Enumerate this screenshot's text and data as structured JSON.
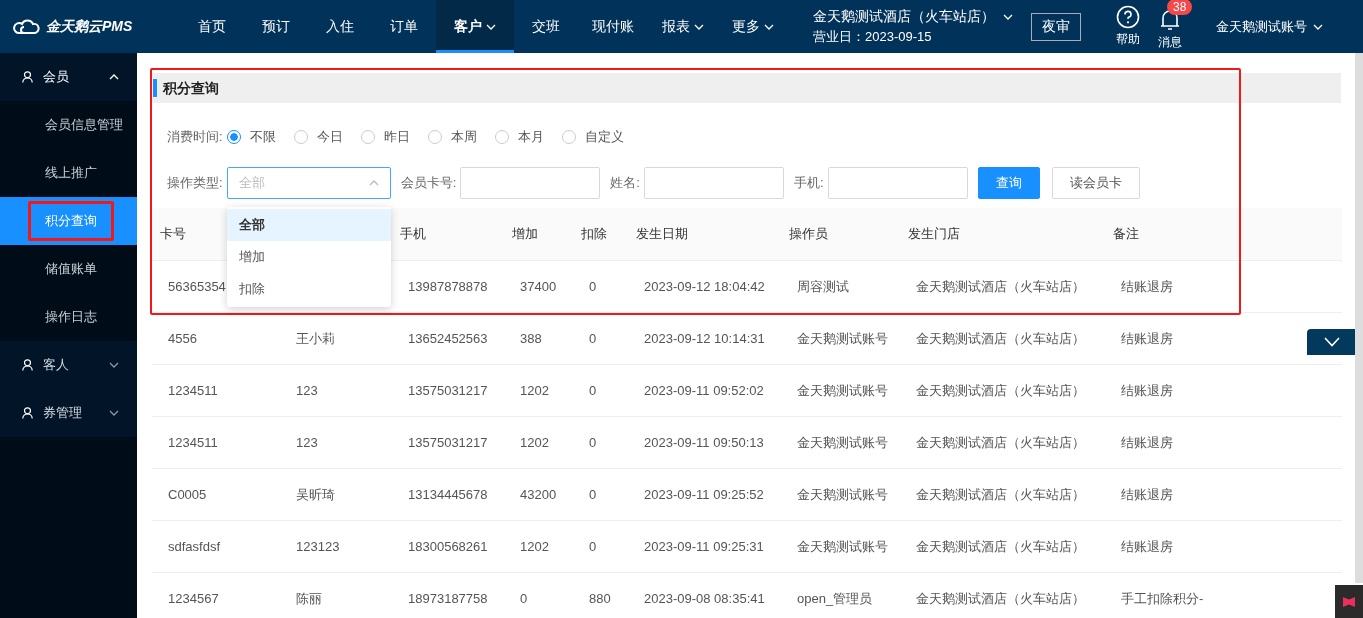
{
  "topbar": {
    "logo": "金天鹅云PMS",
    "nav": [
      {
        "label": "首页",
        "selected": false,
        "has_menu": false
      },
      {
        "label": "预订",
        "selected": false,
        "has_menu": false
      },
      {
        "label": "入住",
        "selected": false,
        "has_menu": false
      },
      {
        "label": "订单",
        "selected": false,
        "has_menu": false
      },
      {
        "label": "客户",
        "selected": true,
        "has_menu": true
      },
      {
        "label": "交班",
        "selected": false,
        "has_menu": false
      },
      {
        "label": "现付账",
        "selected": false,
        "has_menu": false
      },
      {
        "label": "报表",
        "selected": false,
        "has_menu": true
      },
      {
        "label": "更多",
        "selected": false,
        "has_menu": true
      }
    ],
    "hotel": "金天鹅测试酒店（火车站店）",
    "business_day": "营业日：2023-09-15",
    "night_audit": "夜审",
    "help": "帮助",
    "messages": {
      "label": "消息",
      "badge": "38"
    },
    "account": "金天鹅测试账号"
  },
  "sidebar": {
    "groups": [
      {
        "label": "会员",
        "expanded": true,
        "children": [
          {
            "label": "会员信息管理",
            "selected": false,
            "highlighted": false
          },
          {
            "label": "线上推广",
            "selected": false,
            "highlighted": false
          },
          {
            "label": "积分查询",
            "selected": true,
            "highlighted": true
          },
          {
            "label": "储值账单",
            "selected": false,
            "highlighted": false
          },
          {
            "label": "操作日志",
            "selected": false,
            "highlighted": false
          }
        ]
      },
      {
        "label": "客人",
        "expanded": false
      },
      {
        "label": "券管理",
        "expanded": false
      }
    ]
  },
  "panel": {
    "title": "积分查询",
    "highlighted": true,
    "time_filter": {
      "label": "消费时间:",
      "options": [
        {
          "label": "不限",
          "selected": true
        },
        {
          "label": "今日",
          "selected": false
        },
        {
          "label": "昨日",
          "selected": false
        },
        {
          "label": "本周",
          "selected": false
        },
        {
          "label": "本月",
          "selected": false
        },
        {
          "label": "自定义",
          "selected": false
        }
      ]
    },
    "type_filter": {
      "label": "操作类型:",
      "placeholder": "全部",
      "expanded": true,
      "options": [
        {
          "label": "全部",
          "selected": true
        },
        {
          "label": "增加",
          "selected": false
        },
        {
          "label": "扣除",
          "selected": false
        }
      ]
    },
    "fields": [
      {
        "label": "会员卡号:"
      },
      {
        "label": "姓名:"
      },
      {
        "label": "手机:"
      }
    ],
    "buttons": [
      {
        "label": "查询",
        "kind": "primary"
      },
      {
        "label": "读会员卡",
        "kind": "default"
      }
    ]
  },
  "table": {
    "columns": [
      "卡号",
      null,
      "手机",
      "增加",
      "扣除",
      "发生日期",
      "操作员",
      "发生门店",
      "备注"
    ],
    "rows": [
      [
        "56365354",
        null,
        "13987878878",
        "37400",
        "0",
        "2023-09-12 18:04:42",
        "周容测试",
        "金天鹅测试酒店（火车站店）",
        "结账退房"
      ],
      [
        "4556",
        "王小莉",
        "13652452563",
        "388",
        "0",
        "2023-09-12 10:14:31",
        "金天鹅测试账号",
        "金天鹅测试酒店（火车站店）",
        "结账退房"
      ],
      [
        "1234511",
        "123",
        "13575031217",
        "1202",
        "0",
        "2023-09-11 09:52:02",
        "金天鹅测试账号",
        "金天鹅测试酒店（火车站店）",
        "结账退房"
      ],
      [
        "1234511",
        "123",
        "13575031217",
        "1202",
        "0",
        "2023-09-11 09:50:13",
        "金天鹅测试账号",
        "金天鹅测试酒店（火车站店）",
        "结账退房"
      ],
      [
        "C0005",
        "吴昕琦",
        "13134445678",
        "43200",
        "0",
        "2023-09-11 09:25:52",
        "金天鹅测试账号",
        "金天鹅测试酒店（火车站店）",
        "结账退房"
      ],
      [
        "sdfasfdsf",
        "123123",
        "18300568261",
        "1202",
        "0",
        "2023-09-11 09:25:31",
        "金天鹅测试账号",
        "金天鹅测试酒店（火车站店）",
        "结账退房"
      ],
      [
        "1234567",
        "陈丽",
        "18973187758",
        "0",
        "880",
        "2023-09-08 08:35:41",
        "open_管理员",
        "金天鹅测试酒店（火车站店）",
        "手工扣除积分-"
      ]
    ]
  }
}
